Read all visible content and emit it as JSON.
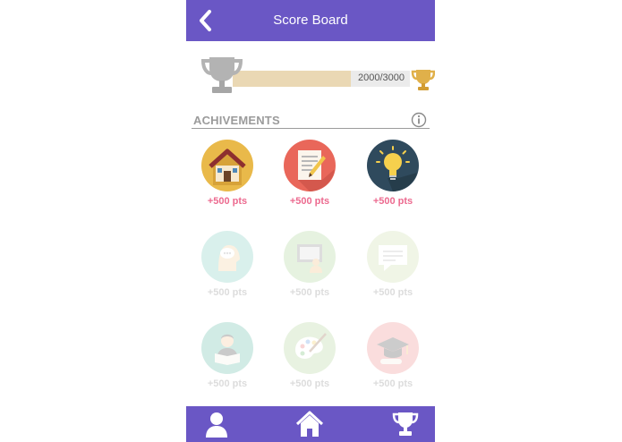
{
  "header": {
    "title": "Score Board",
    "back_icon": "chevron-left-icon"
  },
  "progress": {
    "current": 2000,
    "total": 3000,
    "text": "2000/3000",
    "fraction": 0.667
  },
  "section": {
    "title": "ACHIVEMENTS",
    "info_icon": "info-icon"
  },
  "achievements": [
    {
      "icon": "house-icon",
      "points": "+500 pts",
      "unlocked": true
    },
    {
      "icon": "notepad-pencil-icon",
      "points": "+500 pts",
      "unlocked": true
    },
    {
      "icon": "lightbulb-icon",
      "points": "+500 pts",
      "unlocked": true
    },
    {
      "icon": "speech-head-icon",
      "points": "+500 pts",
      "unlocked": false
    },
    {
      "icon": "monitor-person-icon",
      "points": "+500 pts",
      "unlocked": false
    },
    {
      "icon": "chat-bubble-icon",
      "points": "+500 pts",
      "unlocked": false
    },
    {
      "icon": "reader-icon",
      "points": "+500 pts",
      "unlocked": false
    },
    {
      "icon": "palette-icon",
      "points": "+500 pts",
      "unlocked": false
    },
    {
      "icon": "graduation-cap-icon",
      "points": "+500 pts",
      "unlocked": false
    }
  ],
  "bottom_nav": [
    {
      "icon": "user-icon"
    },
    {
      "icon": "home-icon"
    },
    {
      "icon": "trophy-icon"
    }
  ],
  "colors": {
    "primary": "#6a57c5",
    "points": "#ec6a8f",
    "progress_fill": "#ead8b4",
    "gold": "#e0b04a",
    "silver": "#b3b3b3"
  }
}
